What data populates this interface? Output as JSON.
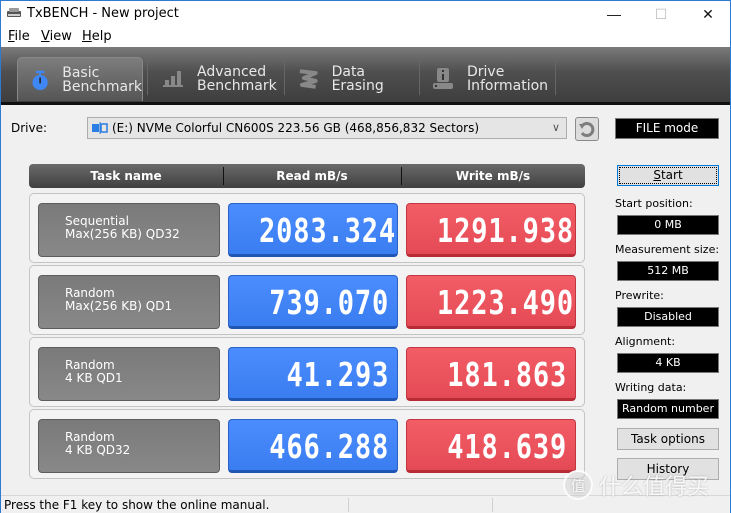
{
  "window": {
    "title": "TxBENCH - New project",
    "controls": {
      "minimize": "—",
      "maximize": "☐",
      "close": "✕"
    }
  },
  "menu": {
    "items": [
      {
        "label": "File",
        "accel": "F",
        "rest": "ile"
      },
      {
        "label": "View",
        "accel": "V",
        "rest": "iew"
      },
      {
        "label": "Help",
        "accel": "H",
        "rest": "elp"
      }
    ]
  },
  "toolbar": {
    "tabs": [
      {
        "line1": "Basic",
        "line2": "Benchmark",
        "icon": "stopwatch-icon",
        "active": true
      },
      {
        "line1": "Advanced",
        "line2": "Benchmark",
        "icon": "bar-chart-icon",
        "active": false
      },
      {
        "line1": "Data Erasing",
        "line2": "",
        "icon": "eraser-icon",
        "active": false
      },
      {
        "line1": "Drive",
        "line2": "Information",
        "icon": "drive-info-icon",
        "active": false
      }
    ]
  },
  "drive": {
    "label": "Drive:",
    "selected": "(E:) NVMe Colorful CN600S  223.56 GB (468,856,832 Sectors)",
    "mode": "FILE mode"
  },
  "table": {
    "headers": [
      "Task name",
      "Read mB/s",
      "Write mB/s"
    ],
    "rows": [
      {
        "task_line1": "Sequential",
        "task_line2": "Max(256 KB) QD32",
        "read": "2083.324",
        "write": "1291.938"
      },
      {
        "task_line1": "Random",
        "task_line2": "Max(256 KB) QD1",
        "read": "739.070",
        "write": "1223.490"
      },
      {
        "task_line1": "Random",
        "task_line2": "4 KB QD1",
        "read": "41.293",
        "write": "181.863"
      },
      {
        "task_line1": "Random",
        "task_line2": "4 KB QD32",
        "read": "466.288",
        "write": "418.639"
      }
    ],
    "colors": {
      "read": "#3f84f7",
      "write": "#ea525c",
      "task": "#7f7f7f"
    }
  },
  "side": {
    "start_label": "Start",
    "start_position_label": "Start position:",
    "start_position": "0 MB",
    "measurement_size_label": "Measurement size:",
    "measurement_size": "512 MB",
    "prewrite_label": "Prewrite:",
    "prewrite": "Disabled",
    "alignment_label": "Alignment:",
    "alignment": "4 KB",
    "writing_data_label": "Writing data:",
    "writing_data": "Random number",
    "task_options_label": "Task options",
    "history_label": "History"
  },
  "status": {
    "text": "Press the F1 key to show the online manual."
  },
  "watermark": {
    "badge": "值",
    "text": "什么值得买"
  }
}
